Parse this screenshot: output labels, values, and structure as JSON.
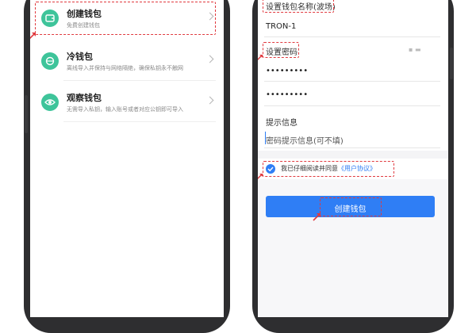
{
  "left_screen": {
    "wallets": [
      {
        "title": "创建钱包",
        "desc": "免费创建钱包",
        "icon": "wallet-create-icon"
      },
      {
        "title": "冷钱包",
        "desc": "离线导入并保持与网络隔绝，确保私钥永不触网",
        "icon": "cold-wallet-icon"
      },
      {
        "title": "观察钱包",
        "desc": "无需导入私钥，输入账号或者对应公钥即可导入",
        "icon": "eye-icon"
      }
    ]
  },
  "right_screen": {
    "wallet_name_label": "设置钱包名称(波场)",
    "wallet_name_value": "TRON-1",
    "password_label": "设置密码",
    "password_value": "•••••••••",
    "password_confirm_value": "•••••••••",
    "hint_label": "提示信息",
    "hint_placeholder": "密码提示信息(可不填)",
    "agree_prefix": "我已仔细阅读并同意",
    "agree_link": "《用户协议》",
    "create_button": "创建钱包"
  },
  "colors": {
    "accent": "#2f7ef5",
    "icon_green": "#3ec49a",
    "annotation_red": "#e0393e",
    "phone_frame": "#2e2e30"
  }
}
